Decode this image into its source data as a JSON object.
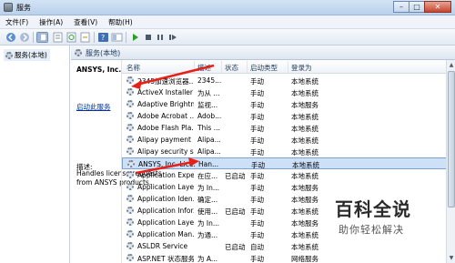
{
  "window": {
    "title": "服务"
  },
  "menu": [
    "文件(F)",
    "操作(A)",
    "查看(V)",
    "帮助(H)"
  ],
  "left_tree": {
    "node_label": "服务(本地)"
  },
  "content_header": "服务(本地)",
  "details": {
    "service_name": "ANSYS, Inc. License Manager",
    "start_link": "启动此服务",
    "description_label": "描述:",
    "description_text": "Handles license requests from ANSYS products."
  },
  "list": {
    "columns": [
      "名称",
      "描述",
      "状态",
      "启动类型",
      "登录为"
    ],
    "rows": [
      {
        "name": "2345加速浏览器...",
        "desc": "2345...",
        "status": "",
        "startup": "手动",
        "logon": "本地系统",
        "selected": false
      },
      {
        "name": "ActiveX Installer ...",
        "desc": "为从 ...",
        "status": "",
        "startup": "手动",
        "logon": "本地系统",
        "selected": false
      },
      {
        "name": "Adaptive Brightn...",
        "desc": "监视...",
        "status": "",
        "startup": "手动",
        "logon": "本地服务",
        "selected": false
      },
      {
        "name": "Adobe Acrobat ...",
        "desc": "Adob...",
        "status": "",
        "startup": "手动",
        "logon": "本地系统",
        "selected": false
      },
      {
        "name": "Adobe Flash Pla...",
        "desc": "This ...",
        "status": "",
        "startup": "手动",
        "logon": "本地系统",
        "selected": false
      },
      {
        "name": "Alipay payment ...",
        "desc": "Alipa...",
        "status": "",
        "startup": "手动",
        "logon": "本地系统",
        "selected": false
      },
      {
        "name": "Alipay security s...",
        "desc": "Alipa...",
        "status": "",
        "startup": "手动",
        "logon": "本地系统",
        "selected": false
      },
      {
        "name": "ANSYS, Inc. Lice...",
        "desc": "Han...",
        "status": "",
        "startup": "手动",
        "logon": "本地系统",
        "selected": true
      },
      {
        "name": "Application Expe...",
        "desc": "在应...",
        "status": "已启动",
        "startup": "手动",
        "logon": "本地系统",
        "selected": false
      },
      {
        "name": "Application Laye...",
        "desc": "为 In...",
        "status": "",
        "startup": "手动",
        "logon": "本地服务",
        "selected": false
      },
      {
        "name": "Application Iden...",
        "desc": "确定...",
        "status": "",
        "startup": "手动",
        "logon": "本地服务",
        "selected": false
      },
      {
        "name": "Application Infor...",
        "desc": "使用...",
        "status": "已启动",
        "startup": "手动",
        "logon": "本地系统",
        "selected": false
      },
      {
        "name": "Application Laye...",
        "desc": "为 In...",
        "status": "",
        "startup": "手动",
        "logon": "本地服务",
        "selected": false
      },
      {
        "name": "Application Man...",
        "desc": "为通...",
        "status": "",
        "startup": "手动",
        "logon": "本地系统",
        "selected": false
      },
      {
        "name": "ASLDR Service",
        "desc": "",
        "status": "已启动",
        "startup": "自动",
        "logon": "本地系统",
        "selected": false
      },
      {
        "name": "ASP.NET 状态服务",
        "desc": "为 A...",
        "status": "",
        "startup": "手动",
        "logon": "网络服务",
        "selected": false
      }
    ]
  },
  "watermark": {
    "title": "百科全说",
    "subtitle": "助你轻松解决"
  },
  "colors": {
    "annotation_arrow": "#e8201a",
    "selection": "#cce0f7",
    "link": "#003399"
  }
}
